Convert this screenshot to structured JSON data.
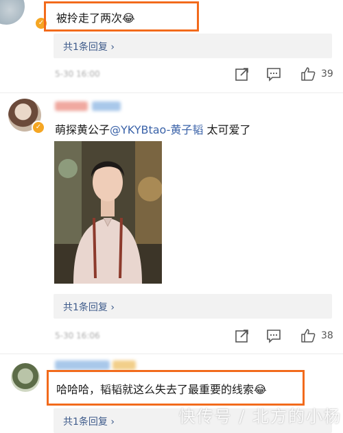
{
  "comments": [
    {
      "text": "被拎走了两次",
      "emoji": "😂",
      "reply_label": "共1条回复 ›",
      "likes": "39",
      "timestamp": "5-30 16:00"
    },
    {
      "text_prefix": "萌探黄公子",
      "mention": "@YKYBtao-黄子韬",
      "text_suffix": " 太可爱了",
      "reply_label": "共1条回复 ›",
      "likes": "38",
      "timestamp": "5-30 16:06"
    },
    {
      "text": "哈哈哈，韬韬就这么失去了最重要的线索",
      "emoji": "😂",
      "reply_label": "共1条回复 ›"
    }
  ],
  "watermark": "快传号 / 北方的小杨",
  "colors": {
    "highlight": "#f26a1b",
    "mention": "#3a62a8",
    "reply_link": "#3d5a8a",
    "verified": "#f5a623"
  },
  "icons": [
    "share-icon",
    "comment-icon",
    "like-icon",
    "verified-badge-icon",
    "chevron-right-icon"
  ]
}
